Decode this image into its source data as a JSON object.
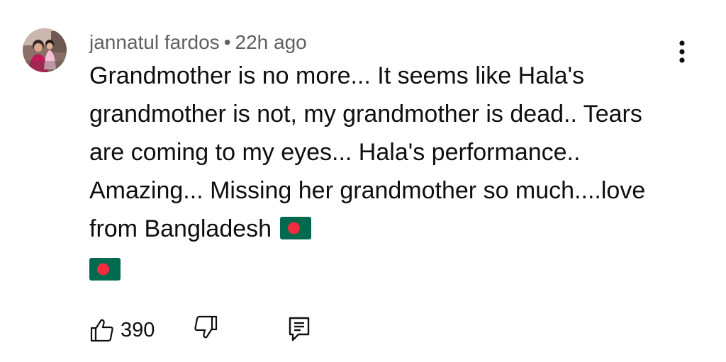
{
  "comment": {
    "author": "jannatul fardos",
    "separator": "•",
    "timestamp": "22h ago",
    "text": "Grandmother is no more... It seems like Hala's grandmother is not, my grandmother is dead.. Tears are coming to my eyes... Hala's performance.. Amazing... Missing her grandmother so much....love from Bangladesh",
    "emoji_flags": [
      "flag-bangladesh",
      "flag-bangladesh"
    ],
    "like_count": "390"
  },
  "icons": {
    "avatar": "avatar-photo",
    "more": "more-vertical-icon",
    "like": "thumbs-up-icon",
    "dislike": "thumbs-down-icon",
    "reply": "reply-comment-icon"
  },
  "colors": {
    "text_primary": "#0f0f0f",
    "text_secondary": "#606060",
    "flag_green": "#006a4e",
    "flag_red": "#f42a41"
  }
}
